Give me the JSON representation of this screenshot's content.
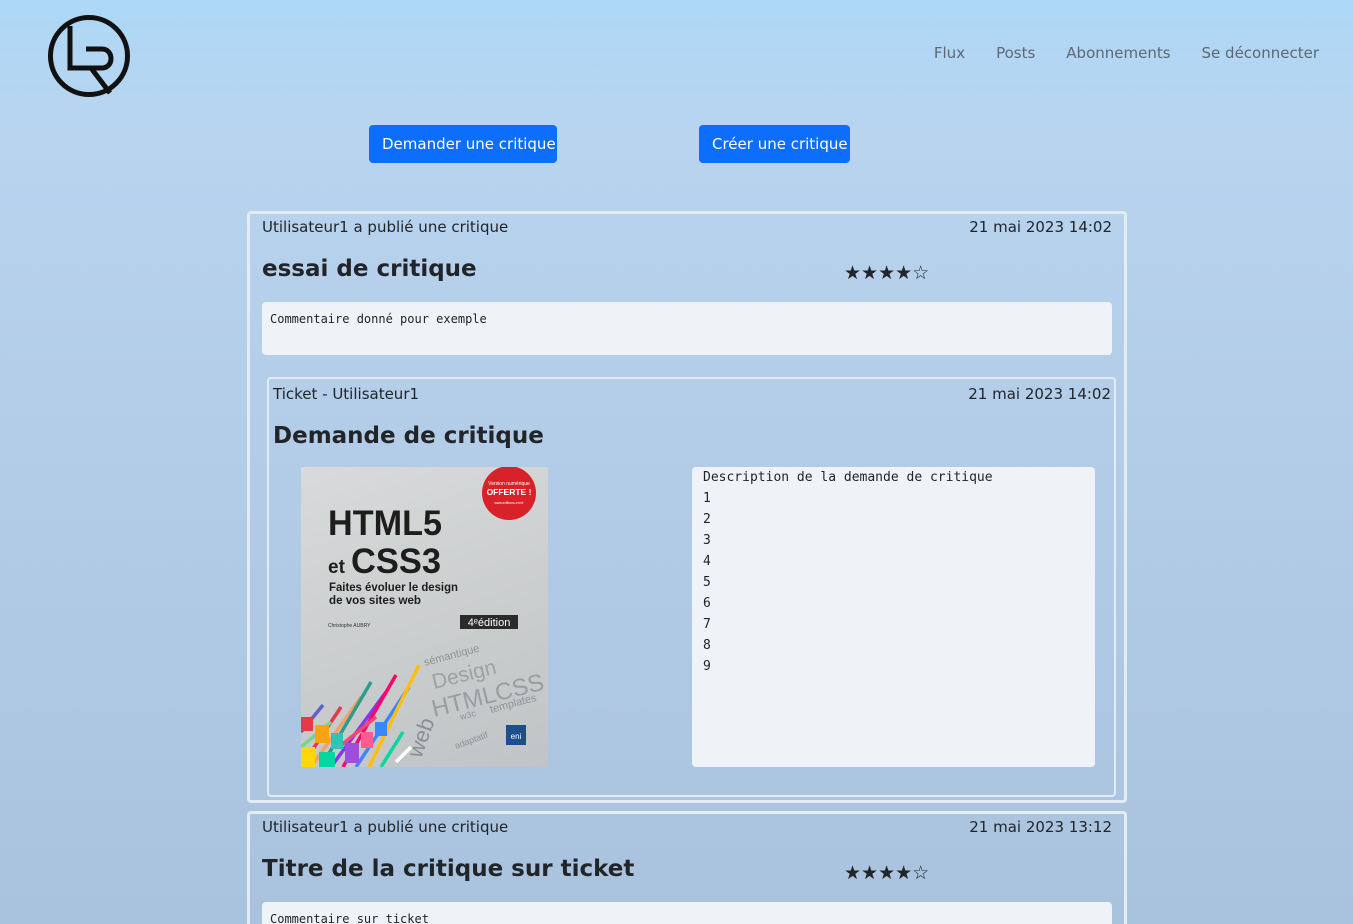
{
  "nav": {
    "logo_text": "LR",
    "links": [
      "Flux",
      "Posts",
      "Abonnements",
      "Se déconnecter"
    ]
  },
  "actions": {
    "ask_review": "Demander une critique",
    "create_review": "Créer une critique"
  },
  "reviews": [
    {
      "header": "Utilisateur1 a publié une critique",
      "date": "21 mai 2023 14:02",
      "title": "essai de critique",
      "rating_stars": "★★★★☆",
      "rating_value": 4,
      "rating_max": 5,
      "comment": "Commentaire donné pour exemple",
      "ticket": {
        "header": "Ticket - Utilisateur1",
        "date": "21 mai 2023 14:02",
        "title": "Demande de critique",
        "description": "Description de la demande de critique\n1\n2\n3\n4\n5\n6\n7\n8\n9",
        "image": {
          "badge_line1": "Version numérique",
          "badge_line2": "OFFERTE !",
          "badge_line3": "www.editions-eni.fr",
          "title_line1": "HTML5",
          "title_line2_small": "et",
          "title_line2": "CSS3",
          "subtitle_line1": "Faites évoluer le design",
          "subtitle_line2": "de vos sites web",
          "author": "Christophe AUBRY",
          "edition": "4ᵉédition",
          "word_semantique": "sémantique",
          "word_design": "Design",
          "word_htmlcss": "HTMLCSS",
          "word_web": "web",
          "word_templates": "templates",
          "word_w3c": "w3c",
          "word_adaptatif": "adaptatif",
          "publisher": "eni"
        }
      }
    },
    {
      "header": "Utilisateur1 a publié une critique",
      "date": "21 mai 2023 13:12",
      "title": "Titre de la critique sur ticket",
      "rating_stars": "★★★★☆",
      "rating_value": 4,
      "rating_max": 5,
      "comment": "Commentaire sur ticket"
    }
  ],
  "colors": {
    "primary_button": "#0d6efd",
    "background_top": "#add8f6",
    "background_bottom": "#a9c2de",
    "panel": "#eff3f8",
    "book_badge": "#d9212a"
  }
}
